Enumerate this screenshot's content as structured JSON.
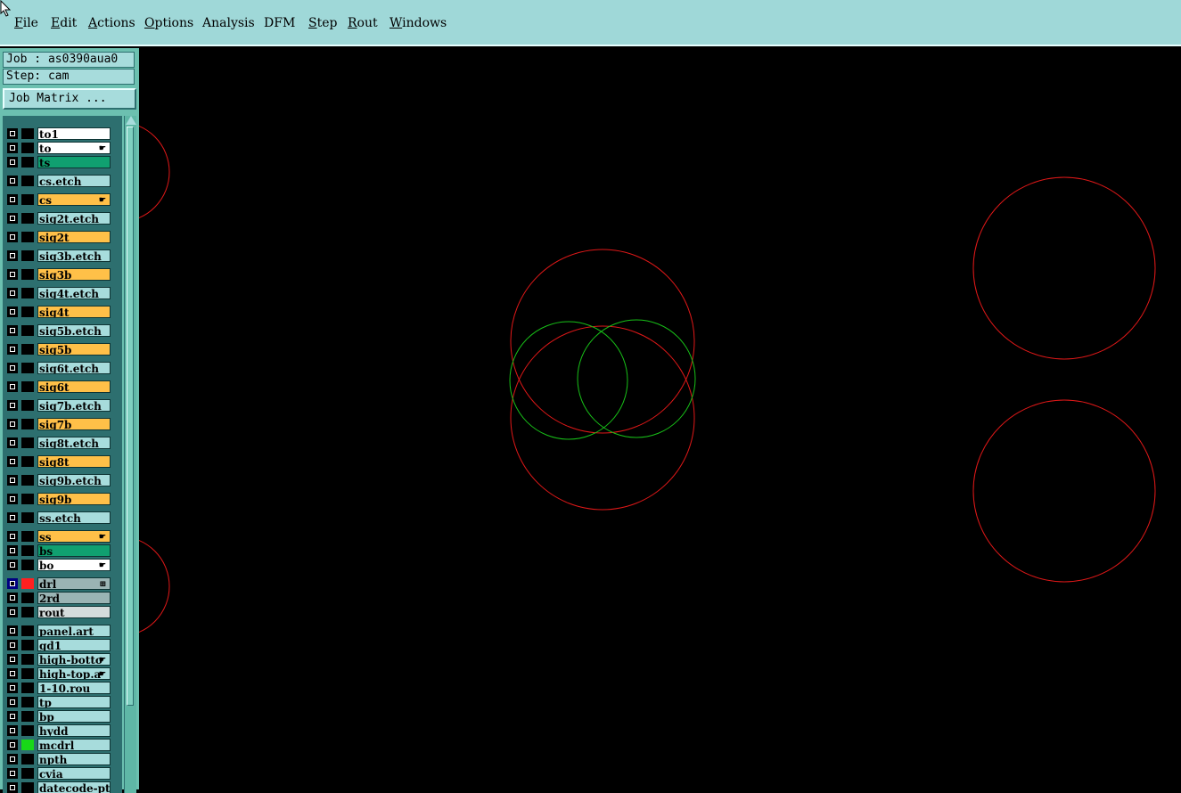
{
  "menu": [
    {
      "label": "File",
      "u": "F",
      "rest": "ile"
    },
    {
      "label": "Edit",
      "u": "E",
      "rest": "dit"
    },
    {
      "label": "Actions",
      "u": "A",
      "rest": "ctions"
    },
    {
      "label": "Options",
      "u": "O",
      "rest": "ptions"
    },
    {
      "label": "Analysis",
      "u": "",
      "rest": "Analysis"
    },
    {
      "label": "DFM",
      "u": "",
      "rest": "DFM"
    },
    {
      "label": "Step",
      "u": "S",
      "rest": "tep"
    },
    {
      "label": "Rout",
      "u": "R",
      "rest": "out"
    },
    {
      "label": "Windows",
      "u": "W",
      "rest": "indows"
    }
  ],
  "job": {
    "label": "Job : as0390aua0"
  },
  "step": {
    "label": "Step: cam"
  },
  "job_matrix": {
    "label": "Job Matrix ..."
  },
  "layers": [
    {
      "name": "to1",
      "style": "white",
      "mark": ""
    },
    {
      "name": "to",
      "style": "white",
      "mark": "hand"
    },
    {
      "name": "ts",
      "style": "green",
      "mark": ""
    },
    {
      "name": "cs.etch",
      "style": "misc",
      "mark": ""
    },
    {
      "name": "cs",
      "style": "sig",
      "mark": "hand"
    },
    {
      "name": "sig2t.etch",
      "style": "misc",
      "mark": ""
    },
    {
      "name": "sig2t",
      "style": "sig",
      "mark": ""
    },
    {
      "name": "sig3b.etch",
      "style": "misc",
      "mark": ""
    },
    {
      "name": "sig3b",
      "style": "sig",
      "mark": ""
    },
    {
      "name": "sig4t.etch",
      "style": "misc",
      "mark": ""
    },
    {
      "name": "sig4t",
      "style": "sig",
      "mark": ""
    },
    {
      "name": "sig5b.etch",
      "style": "misc",
      "mark": ""
    },
    {
      "name": "sig5b",
      "style": "sig",
      "mark": ""
    },
    {
      "name": "sig6t.etch",
      "style": "misc",
      "mark": ""
    },
    {
      "name": "sig6t",
      "style": "sig",
      "mark": ""
    },
    {
      "name": "sig7b.etch",
      "style": "misc",
      "mark": ""
    },
    {
      "name": "sig7b",
      "style": "sig",
      "mark": ""
    },
    {
      "name": "sig8t.etch",
      "style": "misc",
      "mark": ""
    },
    {
      "name": "sig8t",
      "style": "sig",
      "mark": ""
    },
    {
      "name": "sig9b.etch",
      "style": "misc",
      "mark": ""
    },
    {
      "name": "sig9b",
      "style": "sig",
      "mark": ""
    },
    {
      "name": "ss.etch",
      "style": "misc",
      "mark": ""
    },
    {
      "name": "ss",
      "style": "sig",
      "mark": "hand"
    },
    {
      "name": "bs",
      "style": "green",
      "mark": ""
    },
    {
      "name": "bo",
      "style": "white",
      "mark": "hand"
    },
    {
      "name": "drl",
      "style": "drill",
      "mark": "grid",
      "swatch": "#ff2020",
      "active": true
    },
    {
      "name": "2rd",
      "style": "drill",
      "mark": ""
    },
    {
      "name": "rout",
      "style": "rout",
      "mark": ""
    },
    {
      "name": "panel.art",
      "style": "misc",
      "mark": ""
    },
    {
      "name": "gd1",
      "style": "misc",
      "mark": ""
    },
    {
      "name": "high-botto",
      "style": "misc",
      "mark": "hand"
    },
    {
      "name": "high-top.a",
      "style": "misc",
      "mark": "hand"
    },
    {
      "name": "1-10.rou",
      "style": "misc",
      "mark": ""
    },
    {
      "name": "tp",
      "style": "misc",
      "mark": ""
    },
    {
      "name": "bp",
      "style": "misc",
      "mark": ""
    },
    {
      "name": "hydd",
      "style": "misc",
      "mark": ""
    },
    {
      "name": "mcdrl",
      "style": "misc",
      "mark": "",
      "swatch": "#18d818"
    },
    {
      "name": "npth",
      "style": "misc",
      "mark": ""
    },
    {
      "name": "cvia",
      "style": "misc",
      "mark": ""
    },
    {
      "name": "datecode-pt",
      "style": "misc",
      "mark": ""
    }
  ],
  "colors": {
    "red_feature": "#e01818",
    "green_feature": "#18c018"
  }
}
